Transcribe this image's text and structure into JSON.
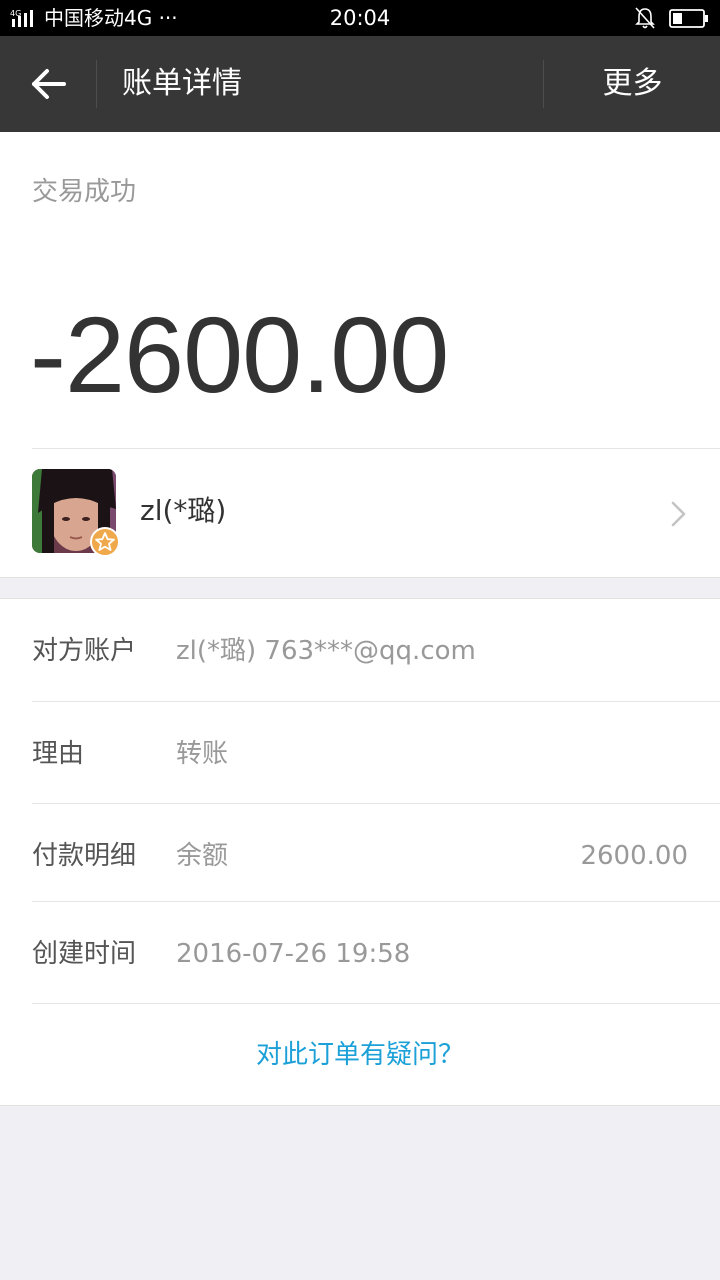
{
  "status_bar": {
    "network_label": "4G",
    "carrier": "中国移动4G ···",
    "time": "20:04"
  },
  "header": {
    "title": "账单详情",
    "more_label": "更多"
  },
  "transaction": {
    "status": "交易成功",
    "amount": "-2600.00",
    "payee_name": "zl(*璐)"
  },
  "details": [
    {
      "label": "对方账户",
      "value": "zl(*璐) 763***@qq.com",
      "extra": ""
    },
    {
      "label": "理由",
      "value": "转账",
      "extra": ""
    },
    {
      "label": "付款明细",
      "value": "余额",
      "extra": "2600.00"
    },
    {
      "label": "创建时间",
      "value": "2016-07-26 19:58",
      "extra": ""
    }
  ],
  "question_link": "对此订单有疑问？",
  "colors": {
    "header_bg": "#373737",
    "link": "#1ba0d8",
    "badge": "#f0a94a"
  }
}
